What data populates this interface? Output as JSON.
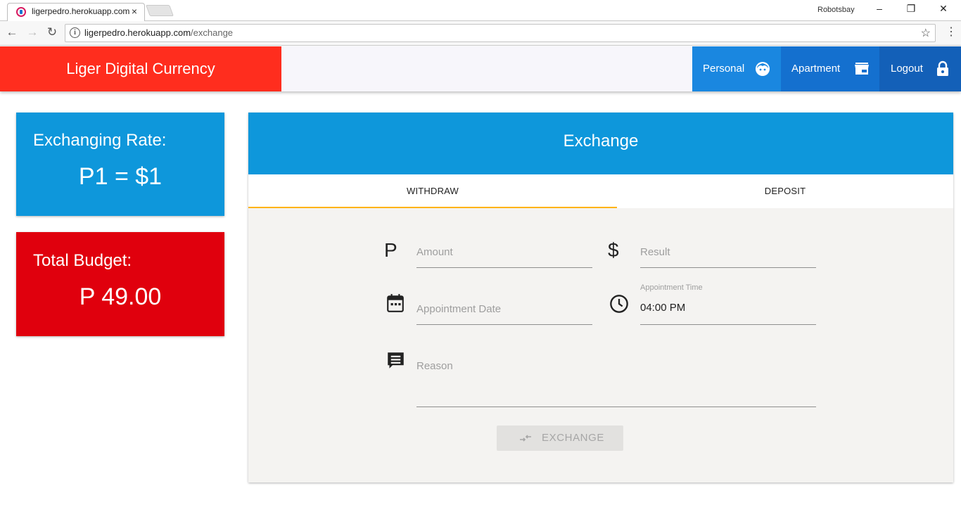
{
  "browser": {
    "tab_title": "ligerpedro.herokuapp.com",
    "tab_close": "×",
    "profile": "Robotsbay",
    "url_host": "ligerpedro.herokuapp.com",
    "url_path": "/exchange"
  },
  "header": {
    "brand": "Liger Digital Currency",
    "nav": [
      {
        "label": "Personal",
        "icon": "face-icon",
        "color": "#1a87e0"
      },
      {
        "label": "Apartment",
        "icon": "store-icon",
        "color": "#1470cf"
      },
      {
        "label": "Logout",
        "icon": "lock-icon",
        "color": "#1360b8"
      }
    ]
  },
  "rate_card": {
    "title": "Exchanging Rate:",
    "value": "P1 = $1",
    "color": "#0e97db"
  },
  "budget_card": {
    "title": "Total Budget:",
    "value": "P 49.00",
    "color": "#e0000d"
  },
  "exchange": {
    "title": "Exchange",
    "tabs": [
      {
        "label": "WITHDRAW",
        "selected": true
      },
      {
        "label": "DEPOSIT",
        "selected": false
      }
    ],
    "amount_icon": "P",
    "amount_placeholder": "Amount",
    "result_icon": "$",
    "result_placeholder": "Result",
    "date_placeholder": "Appointment Date",
    "time_label": "Appointment Time",
    "time_value": "04:00 PM",
    "reason_placeholder": "Reason",
    "button_label": "EXCHANGE",
    "accent": "#ffb300"
  }
}
